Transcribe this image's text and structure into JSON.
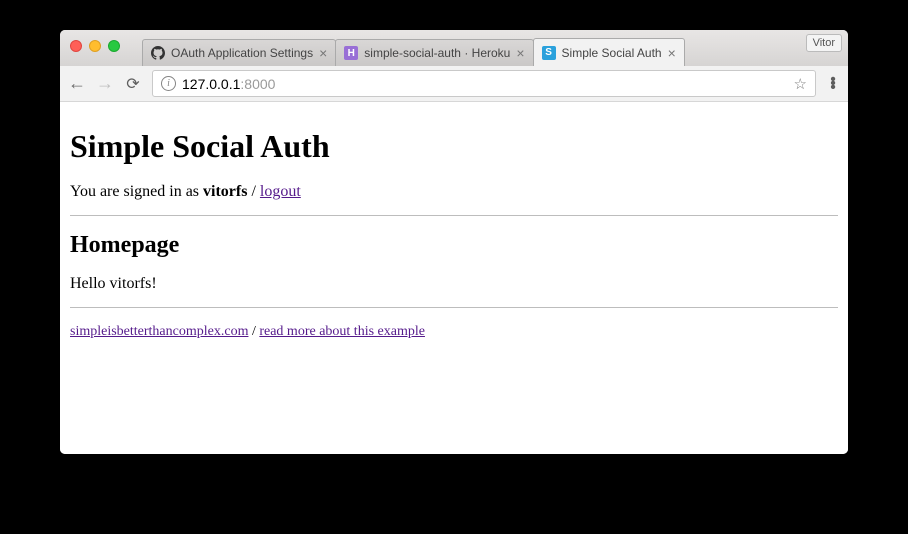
{
  "window": {
    "profile_name": "Vitor"
  },
  "tabs": [
    {
      "label": "OAuth Application Settings",
      "favicon": "github"
    },
    {
      "label": "simple-social-auth · Heroku",
      "favicon": "heroku",
      "favicon_letter": "H"
    },
    {
      "label": "Simple Social Auth",
      "favicon": "app",
      "favicon_letter": "S"
    }
  ],
  "address_bar": {
    "host": "127.0.0.1",
    "port": ":8000"
  },
  "page": {
    "title": "Simple Social Auth",
    "signin_prefix": "You are signed in as ",
    "username": "vitorfs",
    "separator": " / ",
    "logout_label": "logout",
    "section_heading": "Homepage",
    "greeting": "Hello vitorfs!",
    "footer_link_1": "simpleisbetterthancomplex.com",
    "footer_separator": " / ",
    "footer_link_2": "read more about this example"
  }
}
